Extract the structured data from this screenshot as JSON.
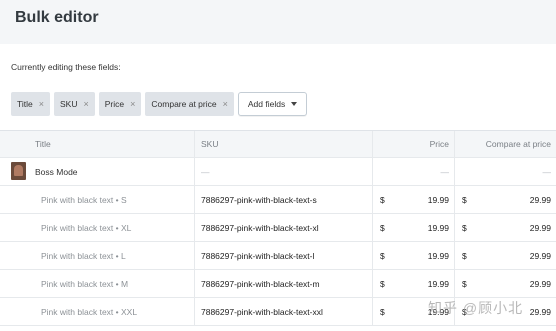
{
  "header": {
    "title": "Bulk editor"
  },
  "editing_label": "Currently editing these fields:",
  "chips": [
    {
      "label": "Title"
    },
    {
      "label": "SKU"
    },
    {
      "label": "Price"
    },
    {
      "label": "Compare at price"
    }
  ],
  "chip_remove": "×",
  "add_fields_label": "Add fields",
  "columns": {
    "title": "Title",
    "sku": "SKU",
    "price": "Price",
    "compare": "Compare at price"
  },
  "product": {
    "title": "Boss Mode",
    "sku": "—",
    "price": "—",
    "compare": "—"
  },
  "currency": "$",
  "variants": [
    {
      "title": "Pink with black text • S",
      "sku": "7886297-pink-with-black-text-s",
      "price": "19.99",
      "compare": "29.99"
    },
    {
      "title": "Pink with black text • XL",
      "sku": "7886297-pink-with-black-text-xl",
      "price": "19.99",
      "compare": "29.99"
    },
    {
      "title": "Pink with black text • L",
      "sku": "7886297-pink-with-black-text-l",
      "price": "19.99",
      "compare": "29.99"
    },
    {
      "title": "Pink with black text • M",
      "sku": "7886297-pink-with-black-text-m",
      "price": "19.99",
      "compare": "29.99"
    },
    {
      "title": "Pink with black text • XXL",
      "sku": "7886297-pink-with-black-text-xxl",
      "price": "19.99",
      "compare": "29.99"
    }
  ],
  "watermark": "知乎 @顾小北"
}
